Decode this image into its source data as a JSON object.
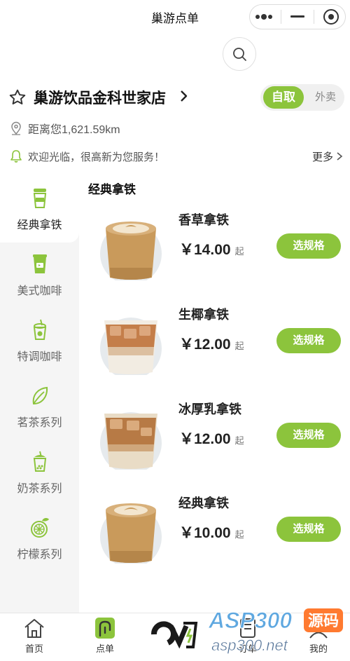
{
  "window": {
    "title": "巢游点单"
  },
  "store": {
    "name": "巢游饮品金科世家店",
    "mode_selected": "自取",
    "mode_other": "外卖"
  },
  "location": {
    "distance": "距离您1,621.59km"
  },
  "notice": {
    "text": "欢迎光临，很高新为您服务！",
    "more": "更多"
  },
  "categories": [
    {
      "label": "经典拿铁",
      "icon": "cup-icon",
      "active": true
    },
    {
      "label": "美式咖啡",
      "icon": "coffee-cup-icon"
    },
    {
      "label": "特调咖啡",
      "icon": "special-drink-icon"
    },
    {
      "label": "茗茶系列",
      "icon": "tea-leaf-icon"
    },
    {
      "label": "奶茶系列",
      "icon": "milk-tea-icon"
    },
    {
      "label": "柠檬系列",
      "icon": "lemon-icon"
    }
  ],
  "section": {
    "title": "经典拿铁"
  },
  "products": [
    {
      "name": "香草拿铁",
      "price": "￥14.00",
      "suffix": "起",
      "button": "选规格"
    },
    {
      "name": "生椰拿铁",
      "price": "￥12.00",
      "suffix": "起",
      "button": "选规格"
    },
    {
      "name": "冰厚乳拿铁",
      "price": "￥12.00",
      "suffix": "起",
      "button": "选规格"
    },
    {
      "name": "经典拿铁",
      "price": "￥10.00",
      "suffix": "起",
      "button": "选规格"
    }
  ],
  "tabbar": {
    "home": "首页",
    "order": "点单",
    "orders": "订单",
    "mine": "我的"
  },
  "watermark": {
    "brand": "ASP300",
    "badge": "源码",
    "site": "asp300.net"
  },
  "colors": {
    "accent": "#8cc43c",
    "sidebar_bg": "#f5f5f5"
  }
}
